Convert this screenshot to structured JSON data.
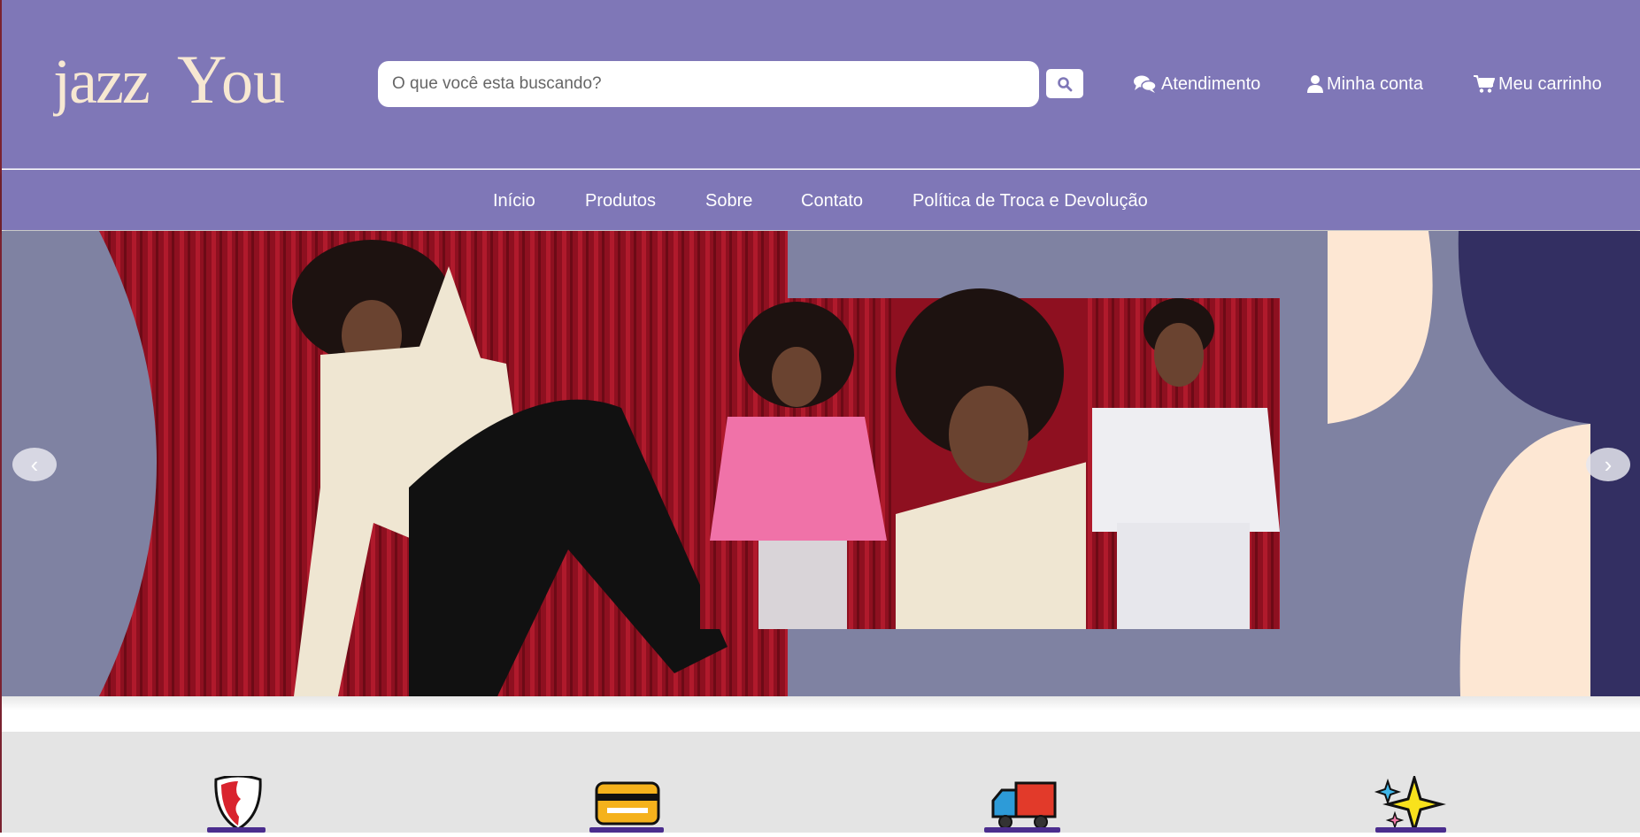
{
  "brand": {
    "name": "JazzYou",
    "accent": "#7f77b7",
    "cream": "#f7e8d2"
  },
  "search": {
    "placeholder": "O que você esta buscando?",
    "icon": "search-icon"
  },
  "header_links": [
    {
      "label": "Atendimento",
      "icon": "chat-icon"
    },
    {
      "label": "Minha conta",
      "icon": "user-icon"
    },
    {
      "label": "Meu carrinho",
      "icon": "cart-icon"
    }
  ],
  "nav": {
    "items": [
      {
        "label": "Início"
      },
      {
        "label": "Produtos"
      },
      {
        "label": "Sobre"
      },
      {
        "label": "Contato"
      },
      {
        "label": "Política de Troca e Devolução"
      }
    ]
  },
  "carousel": {
    "prev_label": "‹",
    "next_label": "›"
  },
  "features": [
    {
      "icon": "shield-icon"
    },
    {
      "icon": "credit-card-icon"
    },
    {
      "icon": "delivery-truck-icon"
    },
    {
      "icon": "sparkles-icon"
    }
  ]
}
